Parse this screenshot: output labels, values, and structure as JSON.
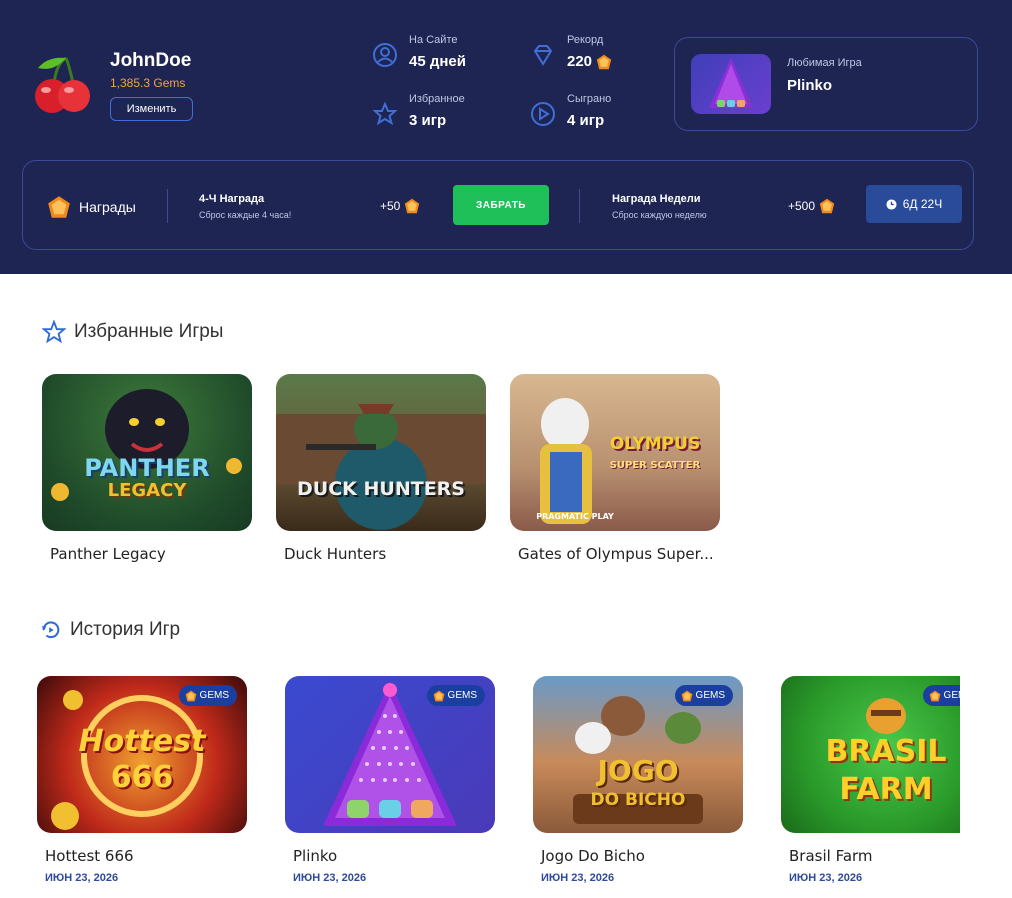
{
  "profile": {
    "username": "JohnDoe",
    "gems": "1,385.3 Gems",
    "edit_label": "Изменить"
  },
  "stats": {
    "on_site_label": "На Сайте",
    "on_site_value": "45 дней",
    "record_label": "Рекорд",
    "record_value": "220",
    "favorites_label": "Избранное",
    "favorites_value": "3 игр",
    "played_label": "Сыграно",
    "played_value": "4 игр"
  },
  "favorite_game": {
    "label": "Любимая Игра",
    "name": "Plinko"
  },
  "rewards": {
    "title": "Награды",
    "four_hour": {
      "name": "4-Ч Награда",
      "sub": "Сброс каждые 4 часа!",
      "amount": "+50",
      "button": "ЗАБРАТЬ"
    },
    "weekly": {
      "name": "Награда Недели",
      "sub": "Сброс каждую неделю",
      "amount": "+500",
      "timer": "6Д 22Ч"
    }
  },
  "favorites_section": {
    "title": "Избранные Игры",
    "games": [
      {
        "name": "Panther Legacy",
        "art_text": "PANTHER",
        "art_sub": "LEGACY"
      },
      {
        "name": "Duck Hunters",
        "art_text": "DUCK HUNTERS"
      },
      {
        "name": "Gates of Olympus Super...",
        "art_text": "OLYMPUS",
        "art_sub": "SUPER SCATTER",
        "provider": "PRAGMATIC PLAY"
      }
    ]
  },
  "history_section": {
    "title": "История Игр",
    "badge": "GEMS",
    "games": [
      {
        "name": "Hottest 666",
        "date": "ИЮН 23, 2026",
        "art_text": "Hottest",
        "art_sub": "666"
      },
      {
        "name": "Plinko",
        "date": "ИЮН 23, 2026"
      },
      {
        "name": "Jogo Do Bicho",
        "date": "ИЮН 23, 2026",
        "art_text": "JOGO",
        "art_sub": "DO BICHO"
      },
      {
        "name": "Brasil Farm",
        "date": "ИЮН 23, 2026",
        "art_text": "BRASIL",
        "art_sub": "FARM"
      }
    ]
  },
  "colors": {
    "header_bg": "#1e2553",
    "accent_gold": "#f1a53a",
    "claim_green": "#1fbf5a",
    "date_blue": "#2f4a9a"
  }
}
